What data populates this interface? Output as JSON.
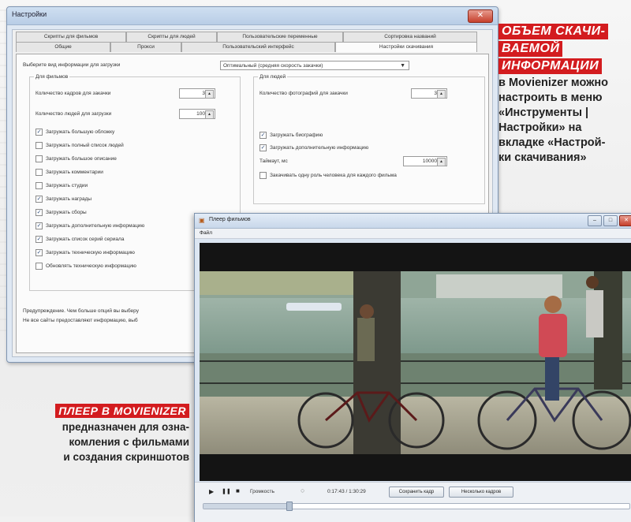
{
  "settings_window": {
    "title": "Настройки",
    "close": "✕",
    "tabs_back": [
      "Скрипты для фильмов",
      "Скрипты для людей",
      "Пользовательские переменные",
      "Сортировка названий"
    ],
    "tabs_front": [
      "Общие",
      "Прокси",
      "Пользовательский интерфейс",
      "Настройки скачивания"
    ],
    "info_label": "Выберите вид информации для загрузки",
    "info_select": "Оптимальный (средняя скорость закачки)",
    "films_group": "Для фильмов",
    "frames_label": "Количество кадров для закачки",
    "frames_value": "3",
    "people_count_label": "Количество людей для загрузки",
    "people_count_value": "100",
    "film_options": [
      {
        "label": "Загружать большую обложку",
        "checked": true
      },
      {
        "label": "Загружать полный список людей",
        "checked": false
      },
      {
        "label": "Загружать большое описание",
        "checked": false
      },
      {
        "label": "Загружать комментарии",
        "checked": false
      },
      {
        "label": "Загружать студии",
        "checked": false
      },
      {
        "label": "Загружать награды",
        "checked": true
      },
      {
        "label": "Загружать сборы",
        "checked": true
      },
      {
        "label": "Загружать дополнительную информацию",
        "checked": true
      },
      {
        "label": "Загружать список серий сериала",
        "checked": true
      },
      {
        "label": "Загружать техническую информацию",
        "checked": true
      },
      {
        "label": "Обновлять техническую информацию",
        "checked": false
      }
    ],
    "people_group": "Для людей",
    "photos_label": "Количество фотографий для закачки",
    "photos_value": "3",
    "people_options": [
      {
        "label": "Загружать биографию",
        "checked": true
      },
      {
        "label": "Загружать дополнительную информацию",
        "checked": true
      }
    ],
    "timeout_label": "Таймаут, мс",
    "timeout_value": "10000",
    "one_role_label": "Закачивать одну роль человека для каждого фильма",
    "warning_line1": "Предупреждение. Чем больше опций вы выберу",
    "warning_line2": "Не все сайты предоставляют информацию, выб"
  },
  "player_window": {
    "title": "Плеер фильмов",
    "menu_file": "Файл",
    "btn_min": "–",
    "btn_max": "□",
    "btn_close": "✕",
    "play_icon": "▶",
    "pause_icon": "❚❚",
    "stop_icon": "■",
    "volume_label": "Громкость",
    "time": "0:17:43 / 1:30:29",
    "save_frame": "Сохранить кадр",
    "multiple_frames": "Несколько кадров",
    "progress": 0.2
  },
  "caption_top": {
    "red_lines": [
      "ОБЪЕМ СКАЧИ-",
      "ВАЕМОЙ",
      "ИНФОРМАЦИИ"
    ],
    "text_lines": [
      "в Movienizer можно",
      "настроить в меню",
      "«Инструменты |",
      "Настройки» на",
      "вкладке «Настрой-",
      "ки скачивания»"
    ]
  },
  "caption_bottom": {
    "red": "ПЛЕЕР В MOVIENIZER",
    "text_lines": [
      "предназначен для озна-",
      "комления с фильмами",
      "и создания скриншотов"
    ]
  },
  "colors": {
    "caption_red": "#d31c1f",
    "window_blue": "#dfe8f3"
  }
}
